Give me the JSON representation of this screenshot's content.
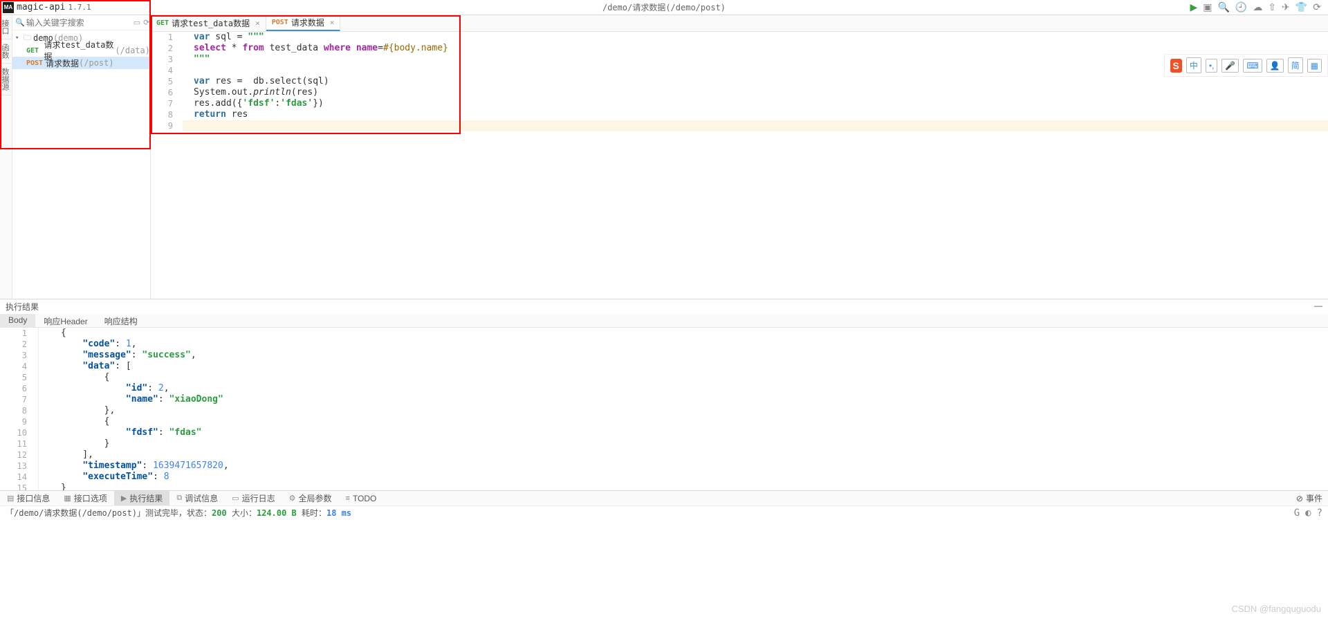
{
  "app": {
    "name": "magic-api",
    "version": "1.7.1"
  },
  "breadcrumb": "/demo/请求数据(/demo/post)",
  "topActions": [
    "run",
    "debug",
    "search",
    "history",
    "cloud-down",
    "cloud-up",
    "send",
    "bug",
    "refresh"
  ],
  "search": {
    "placeholder": "输入关键字搜索"
  },
  "sideTabs": [
    "接口",
    "函数",
    "数据源"
  ],
  "tree": {
    "root": {
      "label": "demo",
      "path": "(demo)"
    },
    "items": [
      {
        "method": "GET",
        "label": "请求test_data数据",
        "path": "(/data)"
      },
      {
        "method": "POST",
        "label": "请求数据",
        "path": "(/post)"
      }
    ]
  },
  "tabs": [
    {
      "method": "GET",
      "label": "请求test_data数据",
      "active": false
    },
    {
      "method": "POST",
      "label": "请求数据",
      "active": true
    }
  ],
  "code": {
    "lines": [
      "var sql = \"\"\"",
      "select * from test_data where name=#{body.name}",
      "\"\"\"",
      "",
      "var res =  db.select(sql)",
      "System.out.println(res)",
      "res.add({'fdsf':'fdas'})",
      "return res",
      ""
    ]
  },
  "ime": {
    "logo": "S",
    "items": [
      "中",
      "•,",
      "🎤",
      "⌨",
      "👤",
      "简",
      "▦"
    ]
  },
  "resultTitle": "执行结果",
  "resultTabs": [
    "Body",
    "响应Header",
    "响应结构"
  ],
  "json": {
    "raw": [
      "{",
      "    \"code\": 1,",
      "    \"message\": \"success\",",
      "    \"data\": [",
      "        {",
      "            \"id\": 2,",
      "            \"name\": \"xiaoDong\"",
      "        },",
      "        {",
      "            \"fdsf\": \"fdas\"",
      "        }",
      "    ],",
      "    \"timestamp\": 1639471657820,",
      "    \"executeTime\": 8",
      "}"
    ]
  },
  "bottomTabs": [
    "接口信息",
    "接口选项",
    "执行结果",
    "调试信息",
    "运行日志",
    "全局参数",
    "TODO"
  ],
  "events": "事件",
  "status": {
    "prefix": "「/demo/请求数据(/demo/post)」测试完毕，状态：",
    "code": "200",
    "sizeLabel": " 大小：",
    "size": "124.00 B",
    "timeLabel": " 耗时：",
    "time": "18 ms"
  },
  "watermark": "CSDN @fangquguodu"
}
